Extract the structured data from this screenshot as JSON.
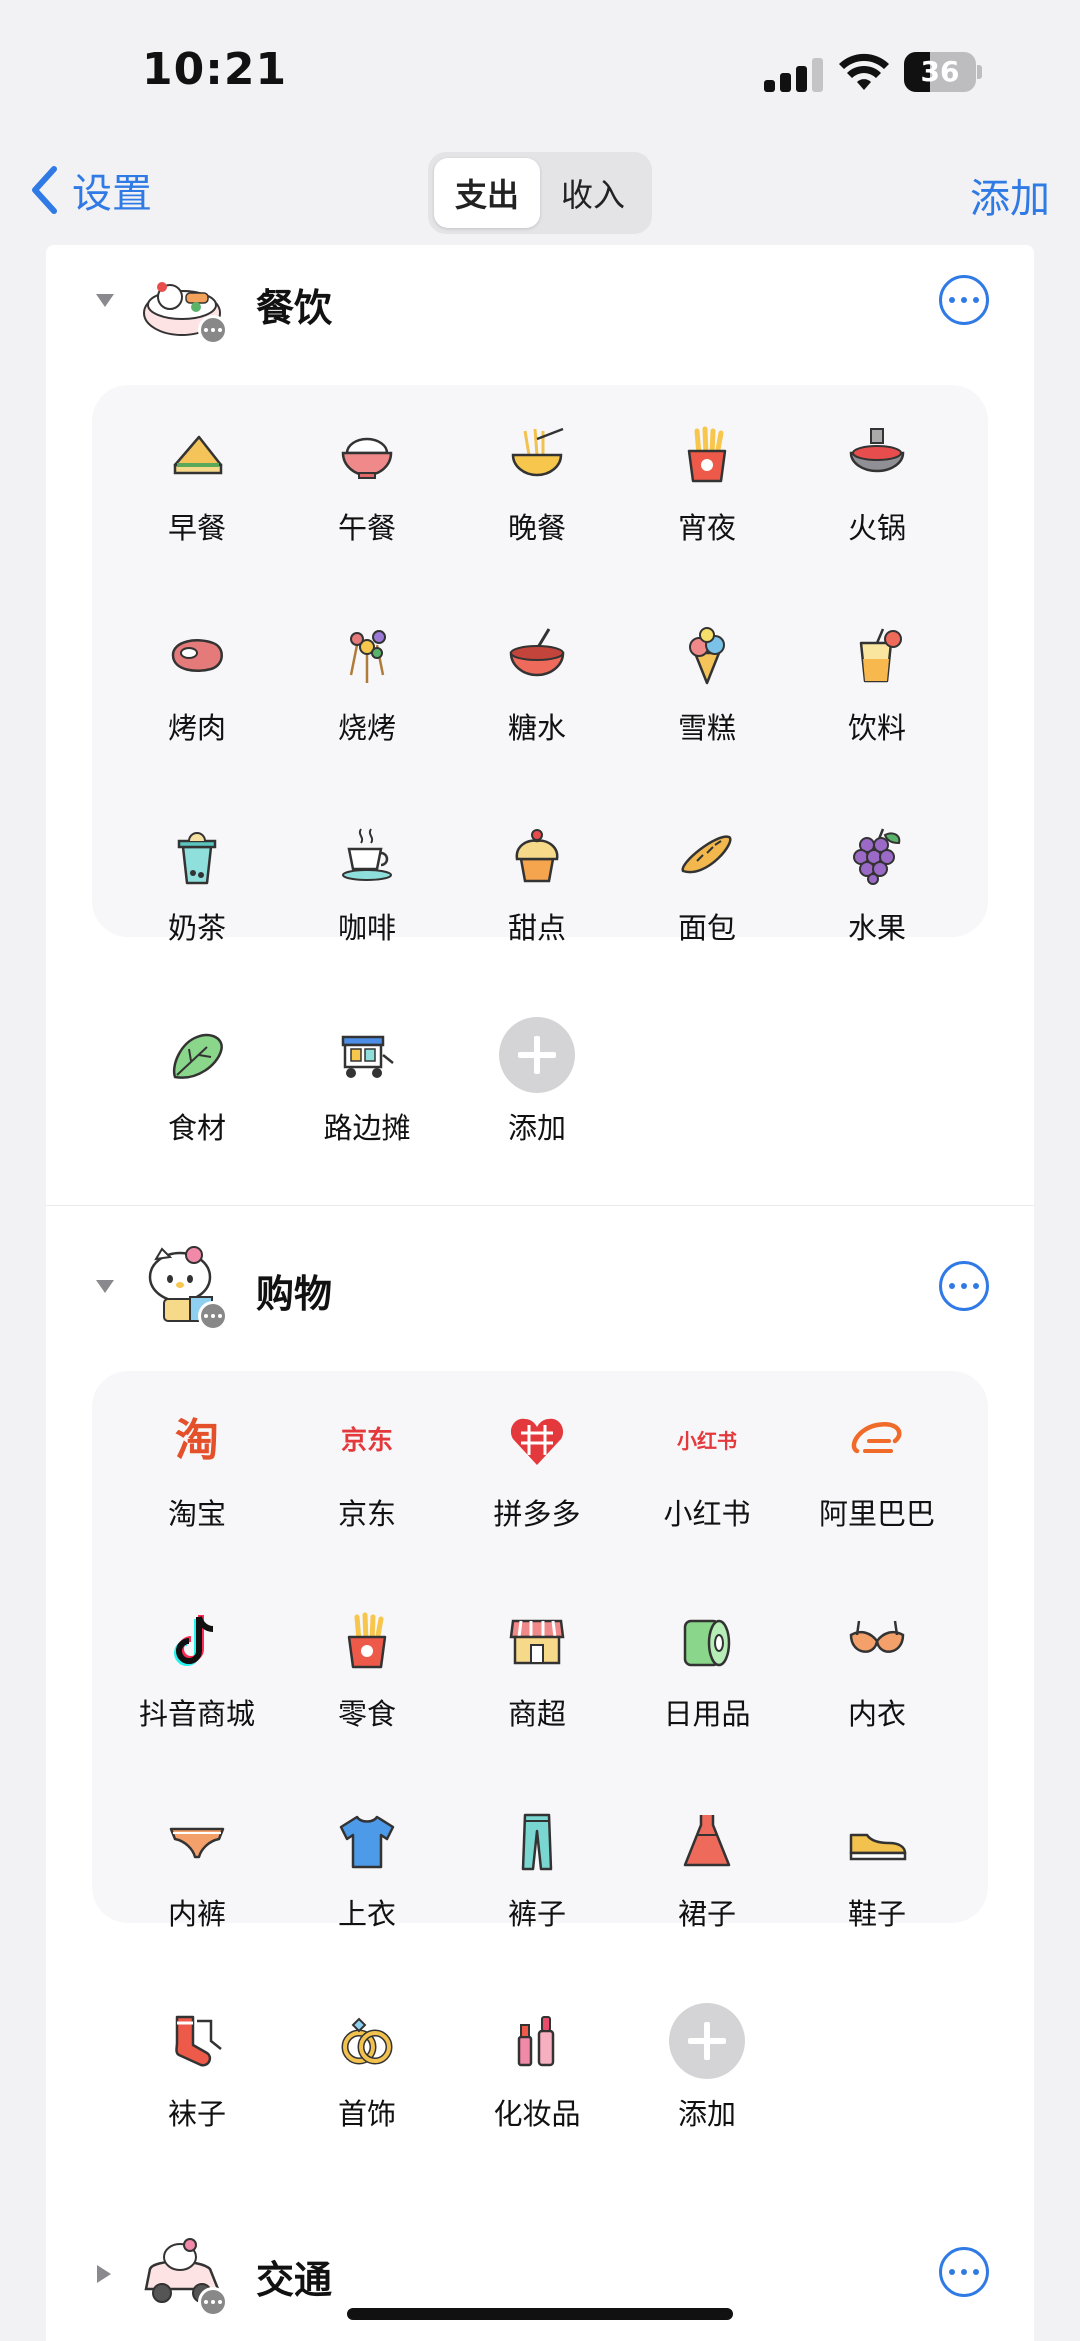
{
  "status": {
    "time": "10:21",
    "battery": "36",
    "battery_level": 0.36
  },
  "nav": {
    "back_label": "设置",
    "tabs": [
      "支出",
      "收入"
    ],
    "active_tab": 0,
    "add_label": "添加"
  },
  "categories": [
    {
      "title": "餐饮",
      "expanded": true,
      "items": [
        {
          "label": "早餐",
          "icon": "sandwich-icon"
        },
        {
          "label": "午餐",
          "icon": "rice-bowl-icon"
        },
        {
          "label": "晚餐",
          "icon": "noodles-icon"
        },
        {
          "label": "宵夜",
          "icon": "fries-icon"
        },
        {
          "label": "火锅",
          "icon": "hotpot-icon"
        },
        {
          "label": "烤肉",
          "icon": "steak-icon"
        },
        {
          "label": "烧烤",
          "icon": "skewer-icon"
        },
        {
          "label": "糖水",
          "icon": "soup-bowl-icon"
        },
        {
          "label": "雪糕",
          "icon": "ice-cream-icon"
        },
        {
          "label": "饮料",
          "icon": "drink-icon"
        },
        {
          "label": "奶茶",
          "icon": "milk-tea-icon"
        },
        {
          "label": "咖啡",
          "icon": "coffee-icon"
        },
        {
          "label": "甜点",
          "icon": "cupcake-icon"
        },
        {
          "label": "面包",
          "icon": "bread-icon"
        },
        {
          "label": "水果",
          "icon": "grapes-icon"
        },
        {
          "label": "食材",
          "icon": "vegetable-icon"
        },
        {
          "label": "路边摊",
          "icon": "street-cart-icon"
        }
      ],
      "add_label": "添加"
    },
    {
      "title": "购物",
      "expanded": true,
      "items": [
        {
          "label": "淘宝",
          "icon": "taobao-icon",
          "logo_text": "淘"
        },
        {
          "label": "京东",
          "icon": "jd-icon",
          "logo_text": "京东"
        },
        {
          "label": "拼多多",
          "icon": "pinduoduo-icon"
        },
        {
          "label": "小红书",
          "icon": "xiaohongshu-icon",
          "logo_text": "小红书"
        },
        {
          "label": "阿里巴巴",
          "icon": "alibaba-icon"
        },
        {
          "label": "抖音商城",
          "icon": "douyin-icon"
        },
        {
          "label": "零食",
          "icon": "snack-icon"
        },
        {
          "label": "商超",
          "icon": "store-icon"
        },
        {
          "label": "日用品",
          "icon": "tissue-roll-icon"
        },
        {
          "label": "内衣",
          "icon": "bra-icon"
        },
        {
          "label": "内裤",
          "icon": "underwear-icon"
        },
        {
          "label": "上衣",
          "icon": "tshirt-icon"
        },
        {
          "label": "裤子",
          "icon": "pants-icon"
        },
        {
          "label": "裙子",
          "icon": "dress-icon"
        },
        {
          "label": "鞋子",
          "icon": "shoe-icon"
        },
        {
          "label": "袜子",
          "icon": "socks-icon"
        },
        {
          "label": "首饰",
          "icon": "rings-icon"
        },
        {
          "label": "化妆品",
          "icon": "cosmetics-icon"
        }
      ],
      "add_label": "添加"
    },
    {
      "title": "交通",
      "expanded": false,
      "items": []
    }
  ],
  "colors": {
    "accent": "#2f7ae5",
    "background": "#f2f2f4",
    "panel": "#f7f7f9"
  }
}
